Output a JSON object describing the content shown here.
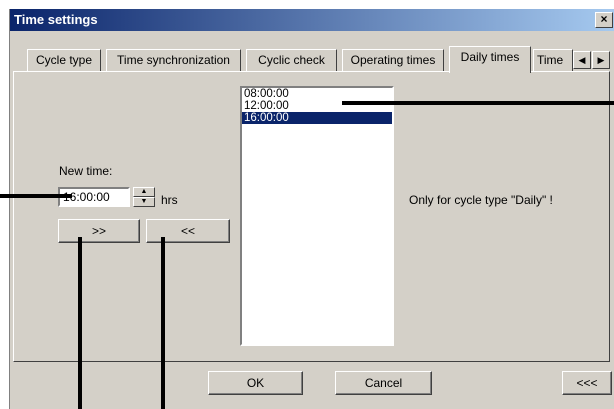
{
  "window": {
    "title": "Time settings",
    "close_label": "×"
  },
  "tabs": [
    {
      "label": "Cycle type"
    },
    {
      "label": "Time synchronization"
    },
    {
      "label": "Cyclic check"
    },
    {
      "label": "Operating times"
    },
    {
      "label": "Daily times",
      "active": true
    },
    {
      "label": "Time"
    }
  ],
  "tab_scroll": {
    "left_icon": "◀",
    "right_icon": "▶"
  },
  "new_time": {
    "label": "New time:",
    "value": "16:00:00",
    "unit": "hrs"
  },
  "spin": {
    "up_icon": "▲",
    "down_icon": "▼"
  },
  "transfer": {
    "add_label": ">>",
    "remove_label": "<<"
  },
  "times_list": {
    "items": [
      "08:00:00",
      "12:00:00",
      "16:00:00"
    ],
    "selected_index": 2
  },
  "note": "Only for cycle type \"Daily\" !",
  "footer": {
    "ok_label": "OK",
    "cancel_label": "Cancel",
    "collapse_label": "<<<"
  },
  "colors": {
    "selection": "#0a246a",
    "face": "#d4d0c8",
    "title_gradient_start": "#0a246a",
    "title_gradient_end": "#a6caf0"
  }
}
